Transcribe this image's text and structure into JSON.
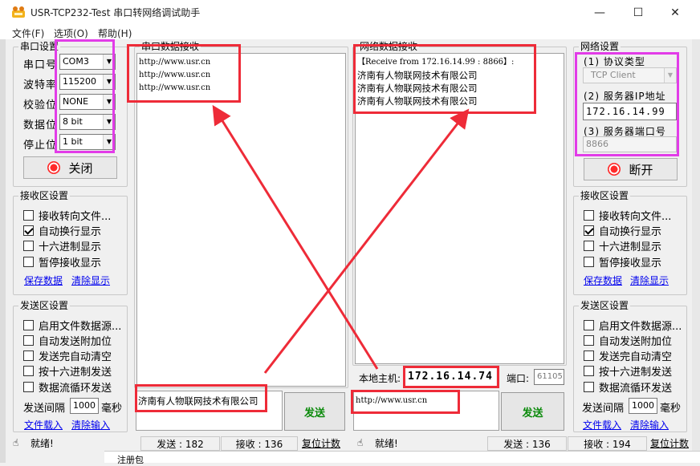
{
  "window": {
    "title": "USR-TCP232-Test 串口转网络调试助手",
    "minimize": "—",
    "maximize": "☐",
    "close": "✕"
  },
  "menu": {
    "file": "文件(F)",
    "options": "选项(O)",
    "help": "帮助(H)"
  },
  "serial_settings": {
    "title": "串口设置",
    "port_label": "串口号",
    "port_value": "COM3",
    "baud_label": "波特率",
    "baud_value": "115200",
    "parity_label": "校验位",
    "parity_value": "NONE",
    "databits_label": "数据位",
    "databits_value": "8 bit",
    "stopbits_label": "停止位",
    "stopbits_value": "1 bit",
    "close_button": "关闭"
  },
  "left_receive_settings": {
    "title": "接收区设置",
    "options": [
      {
        "label": "接收转向文件...",
        "checked": false
      },
      {
        "label": "自动换行显示",
        "checked": true
      },
      {
        "label": "十六进制显示",
        "checked": false
      },
      {
        "label": "暂停接收显示",
        "checked": false
      }
    ],
    "save_link": "保存数据",
    "clear_link": "清除显示"
  },
  "left_send_settings": {
    "title": "发送区设置",
    "options": [
      {
        "label": "启用文件数据源...",
        "checked": false
      },
      {
        "label": "自动发送附加位",
        "checked": false
      },
      {
        "label": "发送完自动清空",
        "checked": false
      },
      {
        "label": "按十六进制发送",
        "checked": false
      },
      {
        "label": "数据流循环发送",
        "checked": false
      }
    ],
    "interval_label": "发送间隔",
    "interval_value": "1000",
    "interval_unit": "毫秒",
    "load_link": "文件载入",
    "clear_link": "清除输入"
  },
  "serial_receive": {
    "title": "串口数据接收",
    "lines": [
      "http://www.usr.cn",
      "http://www.usr.cn",
      "http://www.usr.cn"
    ]
  },
  "serial_send": {
    "text": "济南有人物联网技术有限公司",
    "button": "发送"
  },
  "net_receive": {
    "title": "网络数据接收",
    "header": "【Receive from 172.16.14.99 : 8866】:",
    "lines": [
      "济南有人物联网技术有限公司",
      "济南有人物联网技术有限公司",
      "济南有人物联网技术有限公司"
    ]
  },
  "net_local": {
    "host_label": "本地主机:",
    "host_value": "172.16.14.74",
    "port_label": "端口:",
    "port_value": "61105"
  },
  "net_send": {
    "text": "http://www.usr.cn",
    "button": "发送"
  },
  "net_settings": {
    "title": "网络设置",
    "protocol_label": "(1) 协议类型",
    "protocol_value": "TCP Client",
    "server_ip_label": "(2) 服务器IP地址",
    "server_ip_value": "172.16.14.99",
    "server_port_label": "(3) 服务器端口号",
    "server_port_value": "8866",
    "disconnect_button": "断开"
  },
  "right_receive_settings": {
    "title": "接收区设置",
    "options": [
      {
        "label": "接收转向文件...",
        "checked": false
      },
      {
        "label": "自动换行显示",
        "checked": true
      },
      {
        "label": "十六进制显示",
        "checked": false
      },
      {
        "label": "暂停接收显示",
        "checked": false
      }
    ],
    "save_link": "保存数据",
    "clear_link": "清除显示"
  },
  "right_send_settings": {
    "title": "发送区设置",
    "options": [
      {
        "label": "启用文件数据源...",
        "checked": false
      },
      {
        "label": "自动发送附加位",
        "checked": false
      },
      {
        "label": "发送完自动清空",
        "checked": false
      },
      {
        "label": "按十六进制发送",
        "checked": false
      },
      {
        "label": "数据流循环发送",
        "checked": false
      }
    ],
    "interval_label": "发送间隔",
    "interval_value": "1000",
    "interval_unit": "毫秒",
    "load_link": "文件载入",
    "clear_link": "清除输入"
  },
  "status_left": {
    "ready": "就绪!",
    "sent": "发送 : 182",
    "received": "接收 : 136",
    "reset": "复位计数"
  },
  "status_right": {
    "ready": "就绪!",
    "sent": "发送 : 136",
    "received": "接收 : 194",
    "reset": "复位计数"
  },
  "background_fragment": "注册包",
  "colors": {
    "annotation_red": "#ee2b38",
    "annotation_magenta": "#e23ce8",
    "send_green": "#0a8a0a"
  }
}
